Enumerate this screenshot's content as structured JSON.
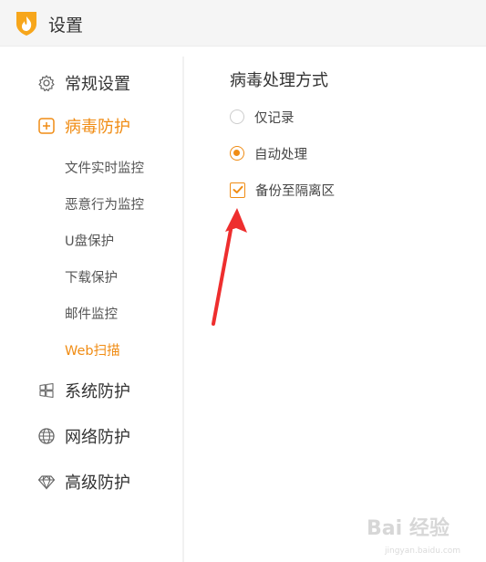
{
  "window": {
    "title": "设置"
  },
  "sidebar": {
    "items": [
      {
        "label": "常规设置",
        "icon": "gear-icon"
      },
      {
        "label": "病毒防护",
        "icon": "plus-square-icon",
        "active": true,
        "subitems": [
          {
            "label": "文件实时监控"
          },
          {
            "label": "恶意行为监控"
          },
          {
            "label": "U盘保护"
          },
          {
            "label": "下载保护"
          },
          {
            "label": "邮件监控"
          },
          {
            "label": "Web扫描",
            "active": true
          }
        ]
      },
      {
        "label": "系统防护",
        "icon": "windows-icon"
      },
      {
        "label": "网络防护",
        "icon": "globe-icon"
      },
      {
        "label": "高级防护",
        "icon": "diamond-icon"
      }
    ]
  },
  "main": {
    "section_title": "病毒处理方式",
    "options": [
      {
        "label": "仅记录",
        "type": "radio",
        "checked": false
      },
      {
        "label": "自动处理",
        "type": "radio",
        "checked": true
      },
      {
        "label": "备份至隔离区",
        "type": "checkbox",
        "checked": true
      }
    ]
  },
  "watermark": {
    "text": "Bai 经验",
    "subtext": "jingyan.baidu.com"
  },
  "colors": {
    "accent": "#f08c14",
    "arrow": "#ee2e2e",
    "titlebar": "#f5f5f5"
  }
}
